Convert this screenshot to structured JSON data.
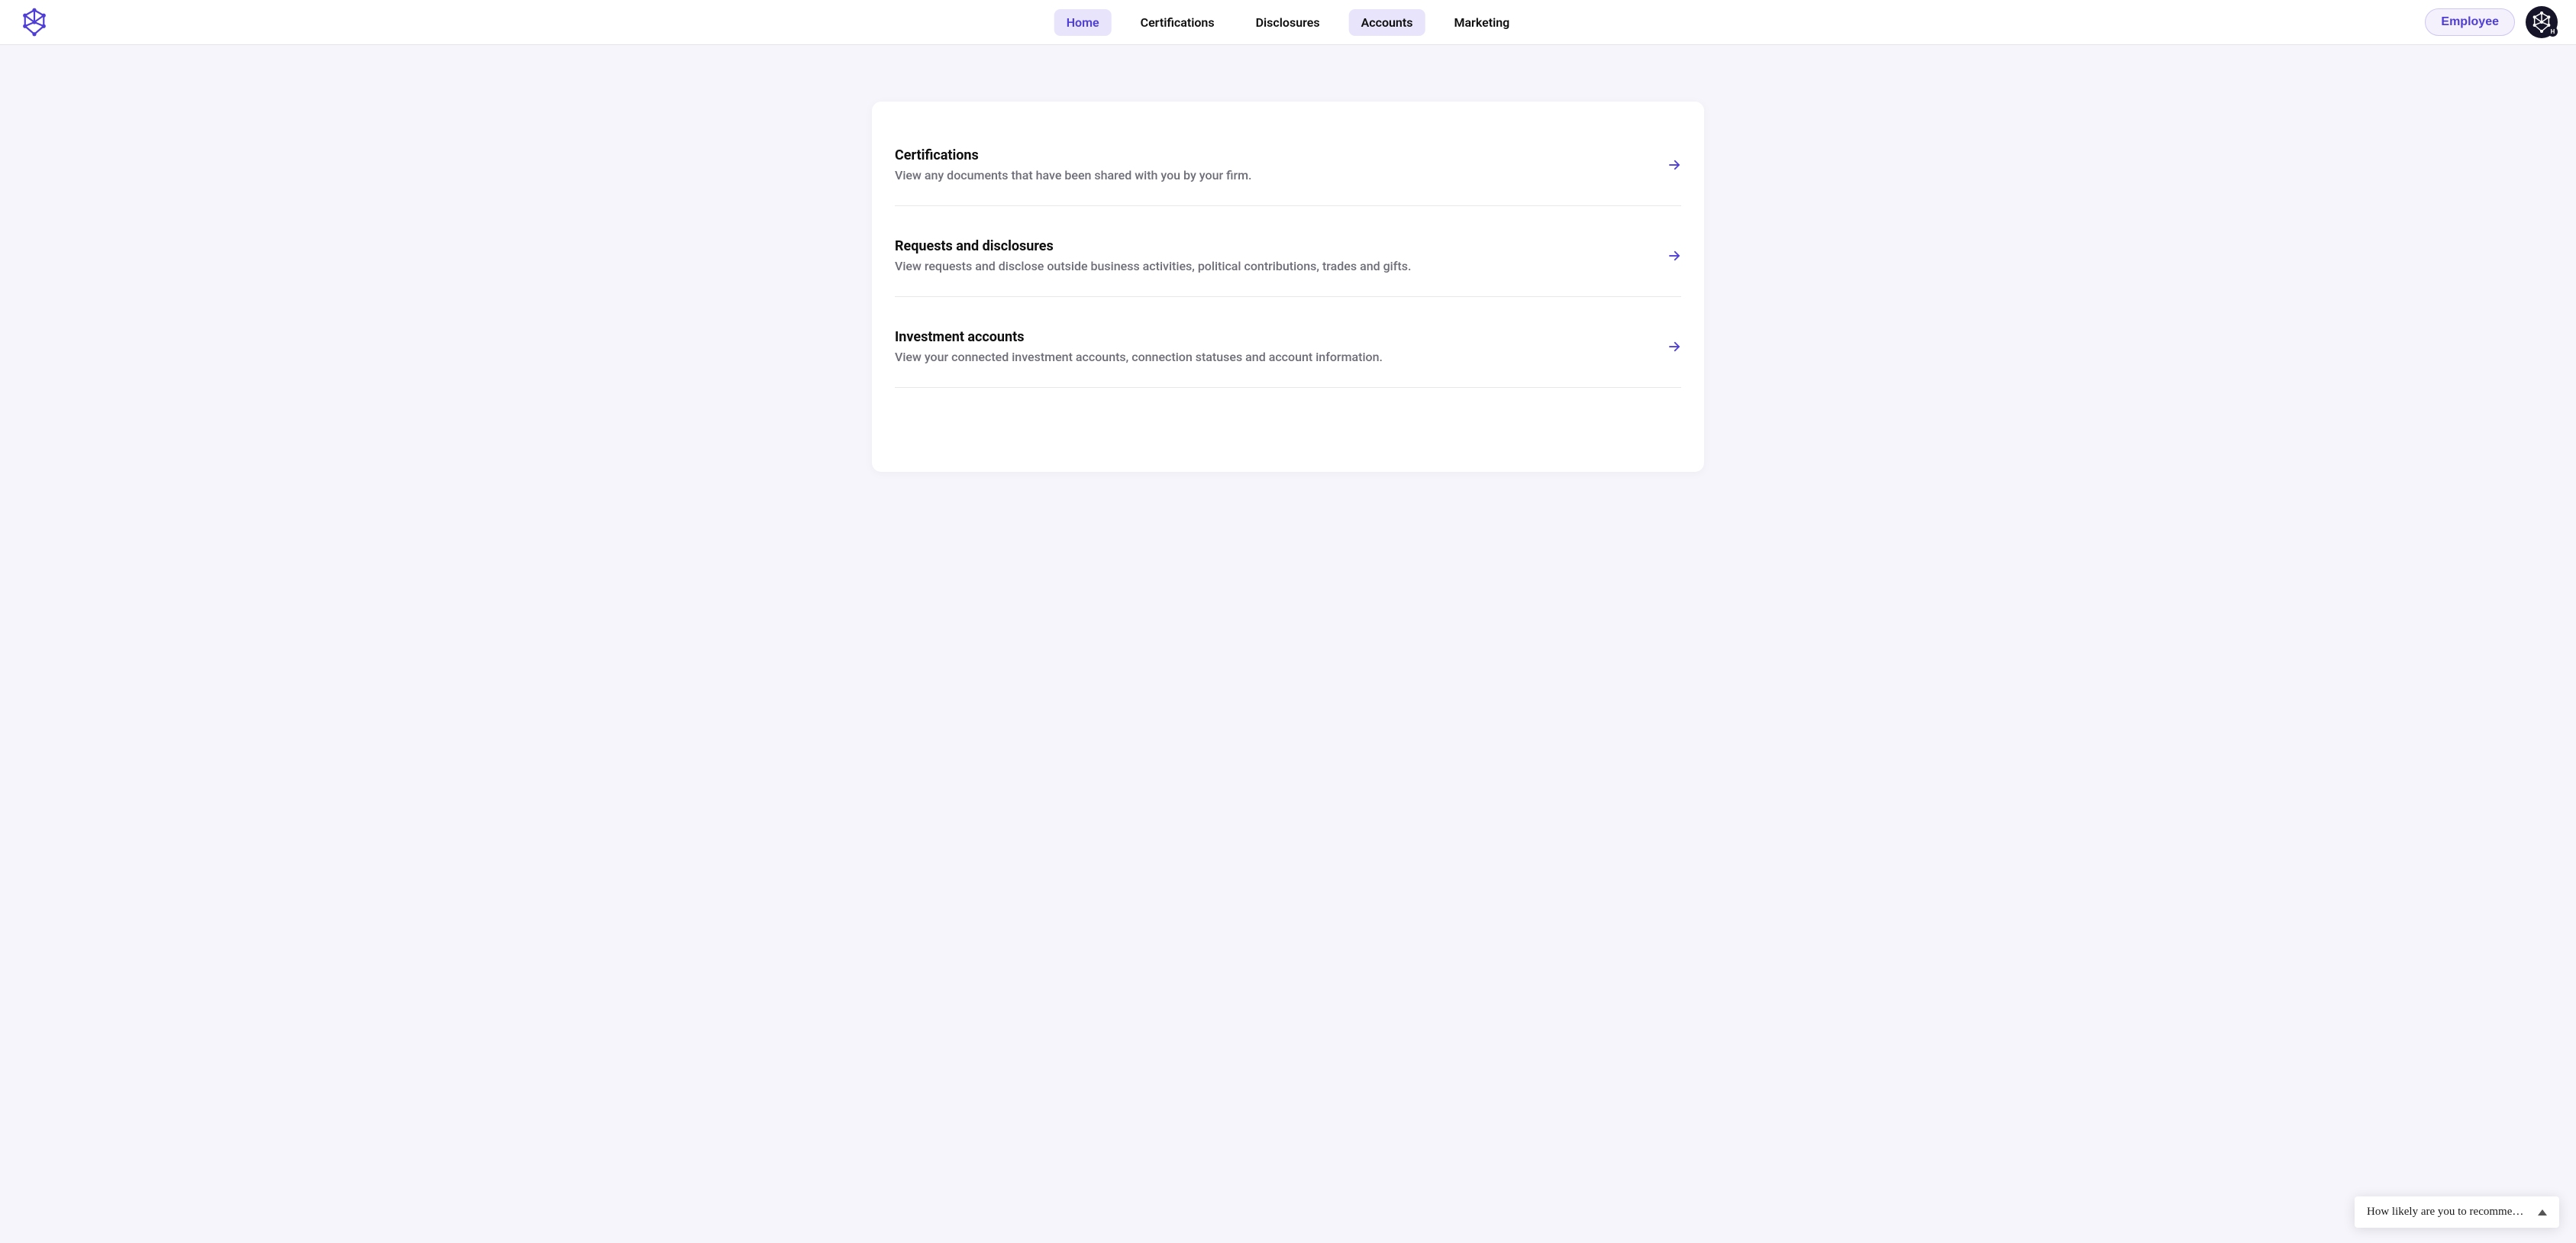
{
  "colors": {
    "accent": "#4f3ed6",
    "accent_bg": "#e8e4fb",
    "page_bg": "#f5f5fb",
    "text_primary": "#0f0f0f",
    "text_secondary": "#6e6e78"
  },
  "header": {
    "logo_icon": "network-graph-icon",
    "nav": [
      {
        "label": "Home",
        "state": "active"
      },
      {
        "label": "Certifications",
        "state": "default"
      },
      {
        "label": "Disclosures",
        "state": "default"
      },
      {
        "label": "Accounts",
        "state": "secondary-active"
      },
      {
        "label": "Marketing",
        "state": "default"
      }
    ],
    "employee_button": "Employee",
    "avatar_icon": "network-graph-icon",
    "avatar_badge": "H"
  },
  "main": {
    "items": [
      {
        "title": "Certifications",
        "description": "View any documents that have been shared with you by your firm."
      },
      {
        "title": "Requests and disclosures",
        "description": "View requests and disclose outside business activities, political contributions, trades and gifts."
      },
      {
        "title": "Investment accounts",
        "description": "View your connected investment accounts, connection statuses and account information."
      }
    ]
  },
  "survey": {
    "text": "How likely are you to recommen…"
  }
}
